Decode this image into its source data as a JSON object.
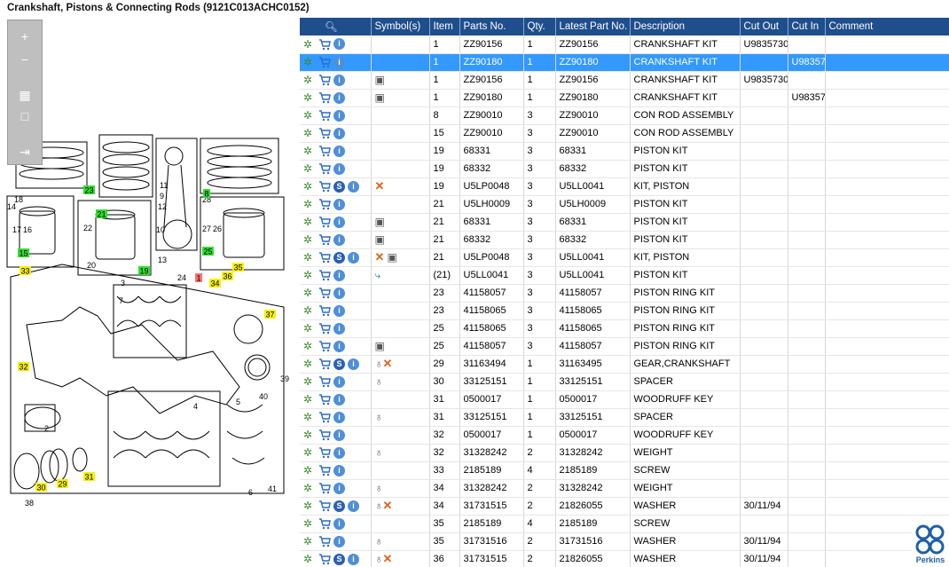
{
  "title": "Crankshaft, Pistons & Connecting Rods (9121C013ACHC0152)",
  "toolbox": {
    "zoom_in": "+",
    "zoom_out": "−",
    "fit": "▦",
    "actual": "□",
    "export": "⇥"
  },
  "columns": [
    "",
    "Symbol(s)",
    "Item",
    "Parts No.",
    "Qty.",
    "Latest Part No.",
    "Description",
    "Cut Out",
    "Cut In",
    "Comment"
  ],
  "rows": [
    {
      "sel": false,
      "s": false,
      "sym": "",
      "item": "1",
      "part": "ZZ90156",
      "qty": "1",
      "latest": "ZZ90156",
      "desc": "CRANKSHAFT KIT",
      "cutout": "U9835730",
      "cutin": "",
      "comment": ""
    },
    {
      "sel": true,
      "s": false,
      "sym": "",
      "item": "1",
      "part": "ZZ90180",
      "qty": "1",
      "latest": "ZZ90180",
      "desc": "CRANKSHAFT KIT",
      "cutout": "",
      "cutin": "U98357",
      "comment": ""
    },
    {
      "sel": false,
      "s": false,
      "sym": "book",
      "item": "1",
      "part": "ZZ90156",
      "qty": "1",
      "latest": "ZZ90156",
      "desc": "CRANKSHAFT KIT",
      "cutout": "U9835730",
      "cutin": "",
      "comment": ""
    },
    {
      "sel": false,
      "s": false,
      "sym": "book",
      "item": "1",
      "part": "ZZ90180",
      "qty": "1",
      "latest": "ZZ90180",
      "desc": "CRANKSHAFT KIT",
      "cutout": "",
      "cutin": "U98357",
      "comment": ""
    },
    {
      "sel": false,
      "s": false,
      "sym": "",
      "item": "8",
      "part": "ZZ90010",
      "qty": "3",
      "latest": "ZZ90010",
      "desc": "CON ROD ASSEMBLY",
      "cutout": "",
      "cutin": "",
      "comment": ""
    },
    {
      "sel": false,
      "s": false,
      "sym": "",
      "item": "15",
      "part": "ZZ90010",
      "qty": "3",
      "latest": "ZZ90010",
      "desc": "CON ROD ASSEMBLY",
      "cutout": "",
      "cutin": "",
      "comment": ""
    },
    {
      "sel": false,
      "s": false,
      "sym": "",
      "item": "19",
      "part": "68331",
      "qty": "3",
      "latest": "68331",
      "desc": "PISTON KIT",
      "cutout": "",
      "cutin": "",
      "comment": ""
    },
    {
      "sel": false,
      "s": false,
      "sym": "",
      "item": "19",
      "part": "68332",
      "qty": "3",
      "latest": "68332",
      "desc": "PISTON KIT",
      "cutout": "",
      "cutin": "",
      "comment": ""
    },
    {
      "sel": false,
      "s": true,
      "sym": "x",
      "item": "19",
      "part": "U5LP0048",
      "qty": "3",
      "latest": "U5LL0041",
      "desc": "KIT, PISTON",
      "cutout": "",
      "cutin": "",
      "comment": ""
    },
    {
      "sel": false,
      "s": false,
      "sym": "",
      "item": "21",
      "part": "U5LH0009",
      "qty": "3",
      "latest": "U5LH0009",
      "desc": "PISTON KIT",
      "cutout": "",
      "cutin": "",
      "comment": ""
    },
    {
      "sel": false,
      "s": false,
      "sym": "book",
      "item": "21",
      "part": "68331",
      "qty": "3",
      "latest": "68331",
      "desc": "PISTON KIT",
      "cutout": "",
      "cutin": "",
      "comment": ""
    },
    {
      "sel": false,
      "s": false,
      "sym": "book",
      "item": "21",
      "part": "68332",
      "qty": "3",
      "latest": "68332",
      "desc": "PISTON KIT",
      "cutout": "",
      "cutin": "",
      "comment": ""
    },
    {
      "sel": false,
      "s": true,
      "sym": "xbook",
      "item": "21",
      "part": "U5LP0048",
      "qty": "3",
      "latest": "U5LL0041",
      "desc": "KIT, PISTON",
      "cutout": "",
      "cutin": "",
      "comment": ""
    },
    {
      "sel": false,
      "s": false,
      "sym": "arrow",
      "item": "(21)",
      "part": "U5LL0041",
      "qty": "3",
      "latest": "U5LL0041",
      "desc": "PISTON KIT",
      "cutout": "",
      "cutin": "",
      "comment": ""
    },
    {
      "sel": false,
      "s": false,
      "sym": "",
      "item": "23",
      "part": "41158057",
      "qty": "3",
      "latest": "41158057",
      "desc": "PISTON RING KIT",
      "cutout": "",
      "cutin": "",
      "comment": ""
    },
    {
      "sel": false,
      "s": false,
      "sym": "",
      "item": "23",
      "part": "41158065",
      "qty": "3",
      "latest": "41158065",
      "desc": "PISTON RING KIT",
      "cutout": "",
      "cutin": "",
      "comment": ""
    },
    {
      "sel": false,
      "s": false,
      "sym": "",
      "item": "25",
      "part": "41158065",
      "qty": "3",
      "latest": "41158065",
      "desc": "PISTON RING KIT",
      "cutout": "",
      "cutin": "",
      "comment": ""
    },
    {
      "sel": false,
      "s": false,
      "sym": "book",
      "item": "25",
      "part": "41158057",
      "qty": "3",
      "latest": "41158057",
      "desc": "PISTON RING KIT",
      "cutout": "",
      "cutin": "",
      "comment": ""
    },
    {
      "sel": false,
      "s": true,
      "sym": "tagx",
      "item": "29",
      "part": "31163494",
      "qty": "1",
      "latest": "31163495",
      "desc": "GEAR,CRANKSHAFT",
      "cutout": "",
      "cutin": "",
      "comment": ""
    },
    {
      "sel": false,
      "s": false,
      "sym": "tag",
      "item": "30",
      "part": "33125151",
      "qty": "1",
      "latest": "33125151",
      "desc": "SPACER",
      "cutout": "",
      "cutin": "",
      "comment": ""
    },
    {
      "sel": false,
      "s": false,
      "sym": "",
      "item": "31",
      "part": "0500017",
      "qty": "1",
      "latest": "0500017",
      "desc": "WOODRUFF KEY",
      "cutout": "",
      "cutin": "",
      "comment": ""
    },
    {
      "sel": false,
      "s": false,
      "sym": "tag",
      "item": "31",
      "part": "33125151",
      "qty": "1",
      "latest": "33125151",
      "desc": "SPACER",
      "cutout": "",
      "cutin": "",
      "comment": ""
    },
    {
      "sel": false,
      "s": false,
      "sym": "",
      "item": "32",
      "part": "0500017",
      "qty": "1",
      "latest": "0500017",
      "desc": "WOODRUFF KEY",
      "cutout": "",
      "cutin": "",
      "comment": ""
    },
    {
      "sel": false,
      "s": false,
      "sym": "tag",
      "item": "32",
      "part": "31328242",
      "qty": "2",
      "latest": "31328242",
      "desc": "WEIGHT",
      "cutout": "",
      "cutin": "",
      "comment": ""
    },
    {
      "sel": false,
      "s": false,
      "sym": "",
      "item": "33",
      "part": "2185189",
      "qty": "4",
      "latest": "2185189",
      "desc": "SCREW",
      "cutout": "",
      "cutin": "",
      "comment": ""
    },
    {
      "sel": false,
      "s": false,
      "sym": "tag",
      "item": "34",
      "part": "31328242",
      "qty": "2",
      "latest": "31328242",
      "desc": "WEIGHT",
      "cutout": "",
      "cutin": "",
      "comment": ""
    },
    {
      "sel": false,
      "s": true,
      "sym": "tagx",
      "item": "34",
      "part": "31731515",
      "qty": "2",
      "latest": "21826055",
      "desc": "WASHER",
      "cutout": "30/11/94",
      "cutin": "",
      "comment": ""
    },
    {
      "sel": false,
      "s": false,
      "sym": "",
      "item": "35",
      "part": "2185189",
      "qty": "4",
      "latest": "2185189",
      "desc": "SCREW",
      "cutout": "",
      "cutin": "",
      "comment": ""
    },
    {
      "sel": false,
      "s": false,
      "sym": "tag",
      "item": "35",
      "part": "31731516",
      "qty": "2",
      "latest": "31731516",
      "desc": "WASHER",
      "cutout": "30/11/94",
      "cutin": "",
      "comment": ""
    },
    {
      "sel": false,
      "s": true,
      "sym": "tagx",
      "item": "36",
      "part": "31731515",
      "qty": "2",
      "latest": "21826055",
      "desc": "WASHER",
      "cutout": "30/11/94",
      "cutin": "",
      "comment": ""
    }
  ],
  "callouts": [
    {
      "t": "33",
      "c": "#f7f000"
    },
    {
      "t": "32",
      "c": "#f7f000"
    },
    {
      "t": "30",
      "c": "#f7f000"
    },
    {
      "t": "29",
      "c": "#f7f000"
    },
    {
      "t": "31",
      "c": "#f7f000"
    },
    {
      "t": "34",
      "c": "#f7f000"
    },
    {
      "t": "35",
      "c": "#f7f000"
    },
    {
      "t": "36",
      "c": "#f7f000"
    },
    {
      "t": "37",
      "c": "#f7f000"
    },
    {
      "t": "23",
      "c": "#33dd33"
    },
    {
      "t": "8",
      "c": "#33dd33"
    },
    {
      "t": "21",
      "c": "#33dd33"
    },
    {
      "t": "15",
      "c": "#33dd33"
    },
    {
      "t": "19",
      "c": "#33dd33"
    },
    {
      "t": "25",
      "c": "#33dd33"
    },
    {
      "t": "1",
      "c": "#ff7070"
    }
  ],
  "labels": [
    "18",
    "14",
    "17",
    "16",
    "22",
    "20",
    "9",
    "11",
    "10",
    "12",
    "13",
    "24",
    "28",
    "27",
    "26",
    "3",
    "7",
    "2",
    "4",
    "5",
    "40",
    "41",
    "6",
    "38",
    "39"
  ],
  "logo_text": "Perkins",
  "colors": {
    "header": "#1f4e8c",
    "selected": "#3399ff"
  }
}
